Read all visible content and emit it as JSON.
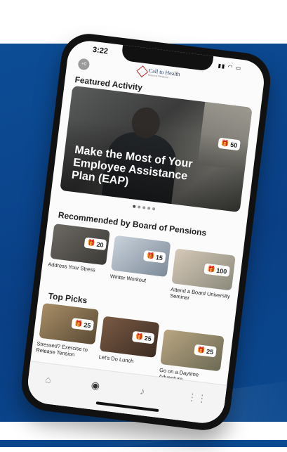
{
  "status": {
    "time": "3:22",
    "signal": "…l ▤ ▬"
  },
  "header": {
    "avatar_initials": "+0",
    "logo_text": "Call to Health",
    "logo_sub": "Board of Pensions"
  },
  "featured": {
    "title": "Featured Activity",
    "card": {
      "title": "Make the Most of Your Employee Assistance Plan (EAP)",
      "points": "50"
    },
    "dots": 5
  },
  "recommended": {
    "title": "Recommended by Board of Pensions",
    "items": [
      {
        "label": "Address Your Stress",
        "points": "20"
      },
      {
        "label": "Winter Workout",
        "points": "15"
      },
      {
        "label": "Attend a Board University Seminar",
        "points": "100"
      }
    ]
  },
  "top_picks": {
    "title": "Top Picks",
    "items": [
      {
        "label": "Stressed? Exercise to Release Tension",
        "points": "25"
      },
      {
        "label": "Let's Do Lunch",
        "points": "25"
      },
      {
        "label": "Go on a Daytime Adventure",
        "points": "25"
      }
    ]
  },
  "nav": {
    "items": [
      "home",
      "explore",
      "notifications",
      "apps"
    ]
  },
  "colors": {
    "background_blue": "#0c4d96",
    "phone_frame": "#111111",
    "logo_red": "#c0282d"
  }
}
